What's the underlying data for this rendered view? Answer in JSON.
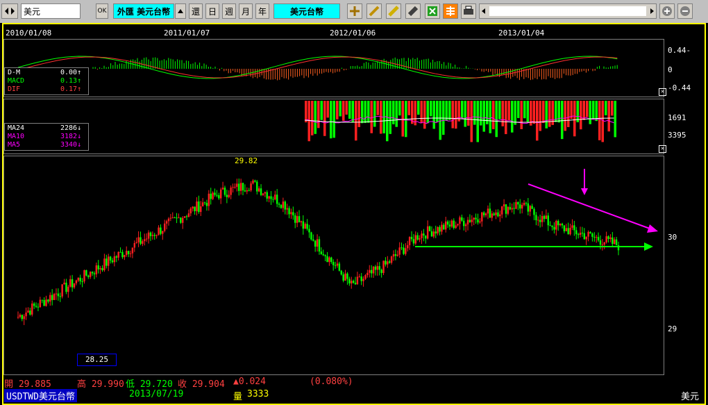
{
  "toolbar": {
    "symbol_field": "美元",
    "ok_label": "OK",
    "product_title": "外匯 美元台幣",
    "product_name": "美元台幣",
    "mode_buttons": [
      "還",
      "日",
      "週",
      "月",
      "年"
    ],
    "accent": "#00ffff"
  },
  "dates": [
    "2010/01/08",
    "2011/01/07",
    "2012/01/06",
    "2013/01/04"
  ],
  "macd_panel": {
    "legend": [
      {
        "name": "DIF",
        "value": "0.17↑",
        "color": "#ff4040"
      },
      {
        "name": "MACD",
        "value": "0.13↑",
        "color": "#00ff00"
      },
      {
        "name": "D-M",
        "value": "0.00↑",
        "color": "#ffffff"
      }
    ],
    "axis": [
      "0.44-",
      "0",
      "-0.44"
    ]
  },
  "volume_panel": {
    "legend": [
      {
        "name": "MA5",
        "value": "3340↓",
        "color": "#ff00ff"
      },
      {
        "name": "MA10",
        "value": "3182↓",
        "color": "#ff00ff"
      },
      {
        "name": "MA24",
        "value": "2286↓",
        "color": "#ffffff"
      }
    ],
    "axis": [
      "1691",
      "3395"
    ]
  },
  "price_panel": {
    "high_label": "29.82",
    "low_label": "28.25",
    "axis": [
      "30",
      "29"
    ]
  },
  "status": {
    "row1": [
      {
        "label": "開",
        "value": "29.885"
      },
      {
        "label": "高",
        "value": "29.990"
      },
      {
        "label": "低",
        "value": "29.720"
      },
      {
        "label": "收",
        "value": "29.904"
      },
      {
        "label": "",
        "value": "▲0.024"
      },
      {
        "label": "",
        "value": "(0.080%)"
      }
    ],
    "row2_symbol": "USDTWD美元台幣",
    "row2_date": "2013/07/19",
    "row2_volume_label": "量",
    "row2_volume": "3333",
    "corner_label": "美元"
  },
  "chart_data": {
    "type": "candlestick",
    "title": "",
    "x_labels": [
      "2010/01/08",
      "2011/01/07",
      "2012/01/06",
      "2013/01/04"
    ],
    "high_value": 29.82,
    "low_value": 28.25,
    "price_axis_ticks": [
      30,
      29
    ],
    "series": [
      {
        "name": "",
        "values": [
          28.5,
          28.7,
          28.9,
          29.1,
          29.3,
          29.5,
          29.7,
          29.8,
          29.6,
          29.2,
          28.8,
          29.0,
          29.3,
          29.4,
          29.5,
          29.6,
          29.4,
          29.3,
          29.2
        ]
      }
    ]
  }
}
